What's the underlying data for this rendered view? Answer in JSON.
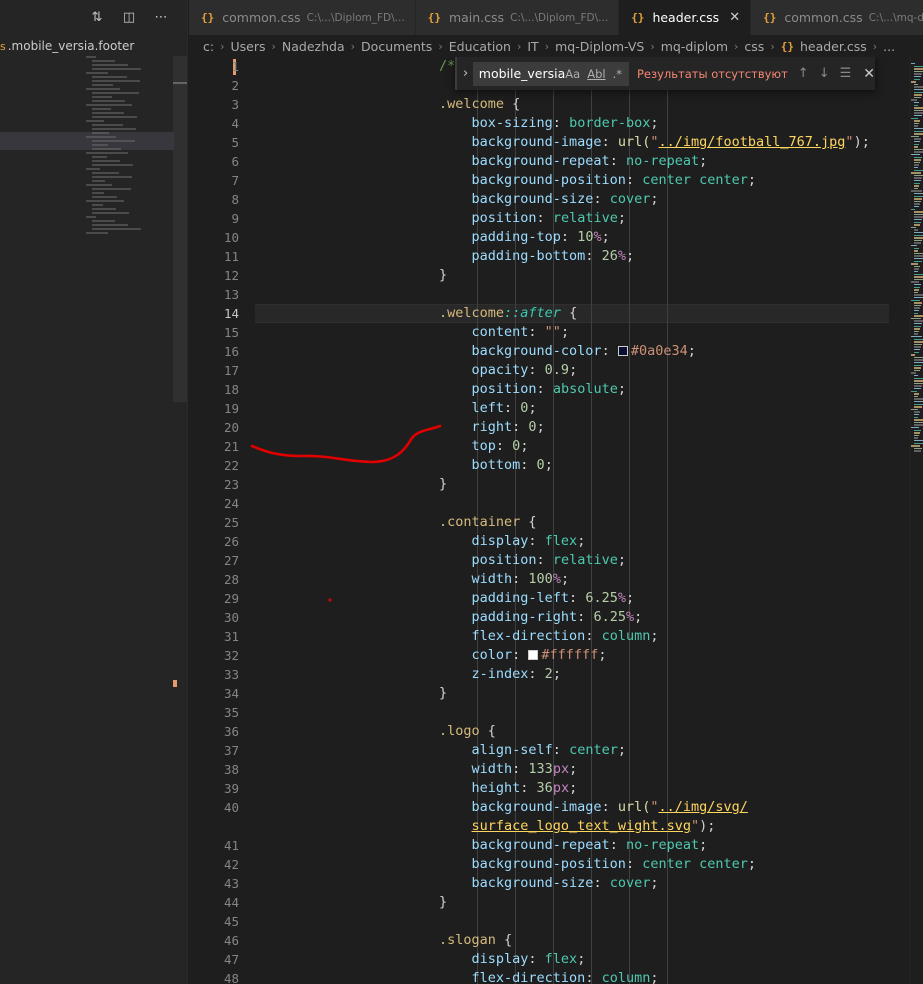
{
  "sidebar": {
    "toolbar_icons": [
      "compare-changes-icon",
      "split-editor-icon",
      "more-actions-icon"
    ],
    "title_prefix": "s",
    "title": ".mobile_versia.footer"
  },
  "tabs": [
    {
      "label": "common.css",
      "desc": "C:\\...\\Diplom_FD\\...",
      "active": false,
      "has_close": false
    },
    {
      "label": "main.css",
      "desc": "C:\\...\\Diplom_FD\\...",
      "active": false,
      "has_close": false
    },
    {
      "label": "header.css",
      "desc": "",
      "active": true,
      "has_close": true
    },
    {
      "label": "common.css",
      "desc": "C:\\...\\mq-dipl",
      "active": false,
      "has_close": false
    }
  ],
  "breadcrumb": [
    "c:",
    "Users",
    "Nadezhda",
    "Documents",
    "Education",
    "IT",
    "mq-Diplom-VS",
    "mq-diplom",
    "css",
    "header.css",
    "..."
  ],
  "find": {
    "value": "mobile_versia",
    "opt_case": "Aa",
    "opt_word": "Abl",
    "opt_regex": ".*",
    "result": "Результаты отсутствуют"
  },
  "editor": {
    "current_line": 14,
    "lines": [
      {
        "n": "1",
        "tokens": [
          {
            "t": "/*",
            "c": "com"
          }
        ]
      },
      {
        "n": "2",
        "tokens": []
      },
      {
        "n": "3",
        "tokens": [
          {
            "t": ".welcome",
            "c": "sel"
          },
          {
            "t": " {",
            "c": "punc"
          }
        ]
      },
      {
        "n": "4",
        "tokens": [
          {
            "t": "    box-sizing",
            "c": "prop"
          },
          {
            "t": ": ",
            "c": "punc"
          },
          {
            "t": "border-box",
            "c": "val"
          },
          {
            "t": ";",
            "c": "punc"
          }
        ]
      },
      {
        "n": "5",
        "tokens": [
          {
            "t": "    background-image",
            "c": "prop"
          },
          {
            "t": ": ",
            "c": "punc"
          },
          {
            "t": "url(",
            "c": "url"
          },
          {
            "t": "\"",
            "c": "str"
          },
          {
            "t": "../img/football_767.jpg",
            "c": "link"
          },
          {
            "t": "\"",
            "c": "str"
          },
          {
            "t": ");",
            "c": "punc"
          }
        ]
      },
      {
        "n": "6",
        "tokens": [
          {
            "t": "    background-repeat",
            "c": "prop"
          },
          {
            "t": ": ",
            "c": "punc"
          },
          {
            "t": "no-repeat",
            "c": "val"
          },
          {
            "t": ";",
            "c": "punc"
          }
        ]
      },
      {
        "n": "7",
        "tokens": [
          {
            "t": "    background-position",
            "c": "prop"
          },
          {
            "t": ": ",
            "c": "punc"
          },
          {
            "t": "center center",
            "c": "val"
          },
          {
            "t": ";",
            "c": "punc"
          }
        ]
      },
      {
        "n": "8",
        "tokens": [
          {
            "t": "    background-size",
            "c": "prop"
          },
          {
            "t": ": ",
            "c": "punc"
          },
          {
            "t": "cover",
            "c": "val"
          },
          {
            "t": ";",
            "c": "punc"
          }
        ]
      },
      {
        "n": "9",
        "tokens": [
          {
            "t": "    position",
            "c": "prop"
          },
          {
            "t": ": ",
            "c": "punc"
          },
          {
            "t": "relative",
            "c": "val"
          },
          {
            "t": ";",
            "c": "punc"
          }
        ]
      },
      {
        "n": "10",
        "tokens": [
          {
            "t": "    padding-top",
            "c": "prop"
          },
          {
            "t": ": ",
            "c": "punc"
          },
          {
            "t": "10",
            "c": "num"
          },
          {
            "t": "%",
            "c": "unit"
          },
          {
            "t": ";",
            "c": "punc"
          }
        ]
      },
      {
        "n": "11",
        "tokens": [
          {
            "t": "    padding-bottom",
            "c": "prop"
          },
          {
            "t": ": ",
            "c": "punc"
          },
          {
            "t": "26",
            "c": "num"
          },
          {
            "t": "%",
            "c": "unit"
          },
          {
            "t": ";",
            "c": "punc"
          }
        ]
      },
      {
        "n": "12",
        "tokens": [
          {
            "t": "}",
            "c": "punc"
          }
        ]
      },
      {
        "n": "13",
        "tokens": []
      },
      {
        "n": "14",
        "tokens": [
          {
            "t": ".welcome",
            "c": "sel"
          },
          {
            "t": "::after",
            "c": "selit"
          },
          {
            "t": " {",
            "c": "punc"
          }
        ]
      },
      {
        "n": "15",
        "tokens": [
          {
            "t": "    content",
            "c": "prop"
          },
          {
            "t": ": ",
            "c": "punc"
          },
          {
            "t": "\"\"",
            "c": "str"
          },
          {
            "t": ";",
            "c": "punc"
          }
        ]
      },
      {
        "n": "16",
        "tokens": [
          {
            "t": "    background-color",
            "c": "prop"
          },
          {
            "t": ": ",
            "c": "punc"
          },
          {
            "swatch": "#0a0e34"
          },
          {
            "t": "#0a0e34",
            "c": "str"
          },
          {
            "t": ";",
            "c": "punc"
          }
        ]
      },
      {
        "n": "17",
        "tokens": [
          {
            "t": "    opacity",
            "c": "prop"
          },
          {
            "t": ": ",
            "c": "punc"
          },
          {
            "t": "0.9",
            "c": "num"
          },
          {
            "t": ";",
            "c": "punc"
          }
        ]
      },
      {
        "n": "18",
        "tokens": [
          {
            "t": "    position",
            "c": "prop"
          },
          {
            "t": ": ",
            "c": "punc"
          },
          {
            "t": "absolute",
            "c": "val"
          },
          {
            "t": ";",
            "c": "punc"
          }
        ]
      },
      {
        "n": "19",
        "tokens": [
          {
            "t": "    left",
            "c": "prop"
          },
          {
            "t": ": ",
            "c": "punc"
          },
          {
            "t": "0",
            "c": "num"
          },
          {
            "t": ";",
            "c": "punc"
          }
        ]
      },
      {
        "n": "20",
        "tokens": [
          {
            "t": "    right",
            "c": "prop"
          },
          {
            "t": ": ",
            "c": "punc"
          },
          {
            "t": "0",
            "c": "num"
          },
          {
            "t": ";",
            "c": "punc"
          }
        ]
      },
      {
        "n": "21",
        "tokens": [
          {
            "t": "    top",
            "c": "prop"
          },
          {
            "t": ": ",
            "c": "punc"
          },
          {
            "t": "0",
            "c": "num"
          },
          {
            "t": ";",
            "c": "punc"
          }
        ]
      },
      {
        "n": "22",
        "tokens": [
          {
            "t": "    bottom",
            "c": "prop"
          },
          {
            "t": ": ",
            "c": "punc"
          },
          {
            "t": "0",
            "c": "num"
          },
          {
            "t": ";",
            "c": "punc"
          }
        ]
      },
      {
        "n": "23",
        "tokens": [
          {
            "t": "}",
            "c": "punc"
          }
        ]
      },
      {
        "n": "24",
        "tokens": []
      },
      {
        "n": "25",
        "tokens": [
          {
            "t": ".container",
            "c": "sel"
          },
          {
            "t": " {",
            "c": "punc"
          }
        ]
      },
      {
        "n": "26",
        "tokens": [
          {
            "t": "    display",
            "c": "prop"
          },
          {
            "t": ": ",
            "c": "punc"
          },
          {
            "t": "flex",
            "c": "val"
          },
          {
            "t": ";",
            "c": "punc"
          }
        ]
      },
      {
        "n": "27",
        "tokens": [
          {
            "t": "    position",
            "c": "prop"
          },
          {
            "t": ": ",
            "c": "punc"
          },
          {
            "t": "relative",
            "c": "val"
          },
          {
            "t": ";",
            "c": "punc"
          }
        ]
      },
      {
        "n": "28",
        "tokens": [
          {
            "t": "    width",
            "c": "prop"
          },
          {
            "t": ": ",
            "c": "punc"
          },
          {
            "t": "100",
            "c": "num"
          },
          {
            "t": "%",
            "c": "unit"
          },
          {
            "t": ";",
            "c": "punc"
          }
        ]
      },
      {
        "n": "29",
        "tokens": [
          {
            "t": "    padding-left",
            "c": "prop"
          },
          {
            "t": ": ",
            "c": "punc"
          },
          {
            "t": "6.25",
            "c": "num"
          },
          {
            "t": "%",
            "c": "unit"
          },
          {
            "t": ";",
            "c": "punc"
          }
        ]
      },
      {
        "n": "30",
        "tokens": [
          {
            "t": "    padding-right",
            "c": "prop"
          },
          {
            "t": ": ",
            "c": "punc"
          },
          {
            "t": "6.25",
            "c": "num"
          },
          {
            "t": "%",
            "c": "unit"
          },
          {
            "t": ";",
            "c": "punc"
          }
        ]
      },
      {
        "n": "31",
        "tokens": [
          {
            "t": "    flex-direction",
            "c": "prop"
          },
          {
            "t": ": ",
            "c": "punc"
          },
          {
            "t": "column",
            "c": "val"
          },
          {
            "t": ";",
            "c": "punc"
          }
        ]
      },
      {
        "n": "32",
        "tokens": [
          {
            "t": "    color",
            "c": "prop"
          },
          {
            "t": ": ",
            "c": "punc"
          },
          {
            "swatch": "#ffffff"
          },
          {
            "t": "#ffffff",
            "c": "str"
          },
          {
            "t": ";",
            "c": "punc"
          }
        ]
      },
      {
        "n": "33",
        "tokens": [
          {
            "t": "    z-index",
            "c": "prop"
          },
          {
            "t": ": ",
            "c": "punc"
          },
          {
            "t": "2",
            "c": "num"
          },
          {
            "t": ";",
            "c": "punc"
          }
        ]
      },
      {
        "n": "34",
        "tokens": [
          {
            "t": "}",
            "c": "punc"
          }
        ]
      },
      {
        "n": "35",
        "tokens": []
      },
      {
        "n": "36",
        "tokens": [
          {
            "t": ".logo",
            "c": "sel"
          },
          {
            "t": " {",
            "c": "punc"
          }
        ]
      },
      {
        "n": "37",
        "tokens": [
          {
            "t": "    align-self",
            "c": "prop"
          },
          {
            "t": ": ",
            "c": "punc"
          },
          {
            "t": "center",
            "c": "val"
          },
          {
            "t": ";",
            "c": "punc"
          }
        ]
      },
      {
        "n": "38",
        "tokens": [
          {
            "t": "    width",
            "c": "prop"
          },
          {
            "t": ": ",
            "c": "punc"
          },
          {
            "t": "133",
            "c": "num"
          },
          {
            "t": "px",
            "c": "unit"
          },
          {
            "t": ";",
            "c": "punc"
          }
        ]
      },
      {
        "n": "39",
        "tokens": [
          {
            "t": "    height",
            "c": "prop"
          },
          {
            "t": ": ",
            "c": "punc"
          },
          {
            "t": "36",
            "c": "num"
          },
          {
            "t": "px",
            "c": "unit"
          },
          {
            "t": ";",
            "c": "punc"
          }
        ]
      },
      {
        "n": "40",
        "tokens": [
          {
            "t": "    background-image",
            "c": "prop"
          },
          {
            "t": ": ",
            "c": "punc"
          },
          {
            "t": "url(",
            "c": "url"
          },
          {
            "t": "\"",
            "c": "str"
          },
          {
            "t": "../img/svg/",
            "c": "link"
          }
        ]
      },
      {
        "n": "",
        "tokens": [
          {
            "t": "    ",
            "c": "punc"
          },
          {
            "t": "surface_logo_text_wight.svg",
            "c": "link"
          },
          {
            "t": "\"",
            "c": "str"
          },
          {
            "t": ");",
            "c": "punc"
          }
        ]
      },
      {
        "n": "41",
        "tokens": [
          {
            "t": "    background-repeat",
            "c": "prop"
          },
          {
            "t": ": ",
            "c": "punc"
          },
          {
            "t": "no-repeat",
            "c": "val"
          },
          {
            "t": ";",
            "c": "punc"
          }
        ]
      },
      {
        "n": "42",
        "tokens": [
          {
            "t": "    background-position",
            "c": "prop"
          },
          {
            "t": ": ",
            "c": "punc"
          },
          {
            "t": "center center",
            "c": "val"
          },
          {
            "t": ";",
            "c": "punc"
          }
        ]
      },
      {
        "n": "43",
        "tokens": [
          {
            "t": "    background-size",
            "c": "prop"
          },
          {
            "t": ": ",
            "c": "punc"
          },
          {
            "t": "cover",
            "c": "val"
          },
          {
            "t": ";",
            "c": "punc"
          }
        ]
      },
      {
        "n": "44",
        "tokens": [
          {
            "t": "}",
            "c": "punc"
          }
        ]
      },
      {
        "n": "45",
        "tokens": []
      },
      {
        "n": "46",
        "tokens": [
          {
            "t": ".slogan",
            "c": "sel"
          },
          {
            "t": " {",
            "c": "punc"
          }
        ]
      },
      {
        "n": "47",
        "tokens": [
          {
            "t": "    display",
            "c": "prop"
          },
          {
            "t": ": ",
            "c": "punc"
          },
          {
            "t": "flex",
            "c": "val"
          },
          {
            "t": ";",
            "c": "punc"
          }
        ]
      },
      {
        "n": "48",
        "tokens": [
          {
            "t": "    flex-direction",
            "c": "prop"
          },
          {
            "t": ": ",
            "c": "punc"
          },
          {
            "t": "column",
            "c": "val"
          },
          {
            "t": ";",
            "c": "punc"
          }
        ]
      }
    ]
  },
  "colors": {
    "accent": "#e8a33c",
    "annotation": "#e00000",
    "find_no_result": "#f48771"
  }
}
